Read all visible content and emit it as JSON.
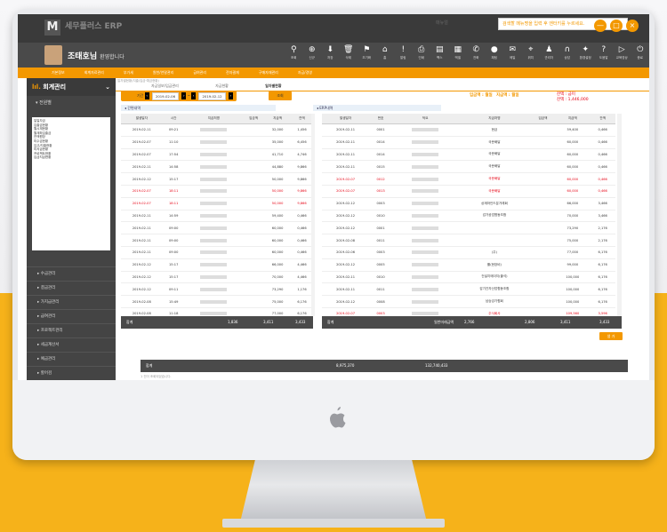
{
  "app": {
    "logo_text": "세무플러스 ERP",
    "top_links": "매뉴얼",
    "search_placeholder": "검색할 메뉴명을 입력 후 엔터키를 누르세요.",
    "user_name": "조태호님",
    "user_greeting": "환영합니다",
    "win_buttons": [
      "—",
      "□",
      "×"
    ]
  },
  "icons": [
    {
      "name": "search-icon",
      "glyph": "⚲",
      "label": "조회"
    },
    {
      "name": "add-icon",
      "glyph": "⊕",
      "label": "신규"
    },
    {
      "name": "save-icon",
      "glyph": "⬇",
      "label": "저장"
    },
    {
      "name": "delete-icon",
      "glyph": "🗑",
      "label": "삭제"
    },
    {
      "name": "flag-icon",
      "glyph": "⚑",
      "label": "초기화"
    },
    {
      "name": "home-icon",
      "glyph": "⌂",
      "label": "홈"
    },
    {
      "name": "alert-icon",
      "glyph": "!",
      "label": "알림"
    },
    {
      "name": "print-icon",
      "glyph": "⎙",
      "label": "인쇄"
    },
    {
      "name": "fax-icon",
      "glyph": "▤",
      "label": "팩스"
    },
    {
      "name": "excel-icon",
      "glyph": "▦",
      "label": "엑셀"
    },
    {
      "name": "phone-icon",
      "glyph": "✆",
      "label": "전화"
    },
    {
      "name": "chat-icon",
      "glyph": "●",
      "label": "채팅"
    },
    {
      "name": "mail-icon",
      "glyph": "✉",
      "label": "메일"
    },
    {
      "name": "location-icon",
      "glyph": "⌖",
      "label": "위치"
    },
    {
      "name": "person-icon",
      "glyph": "♟",
      "label": "관리자"
    },
    {
      "name": "headset-icon",
      "glyph": "∩",
      "label": "상담"
    },
    {
      "name": "settings-icon",
      "glyph": "✦",
      "label": "환경설정"
    },
    {
      "name": "help-icon",
      "glyph": "?",
      "label": "도움말"
    },
    {
      "name": "video-icon",
      "glyph": "▷",
      "label": "교육영상"
    },
    {
      "name": "exit-icon",
      "glyph": "⏻",
      "label": "종료"
    }
  ],
  "menu": [
    "기본정보",
    "회계자료관리",
    "부가세",
    "원천/연말관리",
    "급여관리",
    "전자결재",
    "구매자재관리",
    "자금/경영"
  ],
  "sidebar": {
    "title": "회계관리",
    "sub": "전원별",
    "tree": [
      "일일자금",
      "입출금현황",
      "월시재현황",
      "월계좌입출금",
      "잔액원장",
      "미수금현황",
      "입고/지출현황",
      "미지급현황",
      "프로젝트현황",
      "입금지급현황"
    ],
    "menus": [
      "수금관리",
      "결금관리",
      "가지급관리",
      "급여관리",
      "프로젝트관리",
      "세금계산서",
      "예금관리",
      "할어검"
    ]
  },
  "main": {
    "crumb": "일자별현황(지출/입금·예금현황)",
    "tabs": [
      "자금일보/입금관리",
      "자금현황",
      "일자별현황"
    ],
    "filter_label": "기간",
    "date_from": "2019-02-06",
    "date_to": "2019-02-12",
    "search_btn": "조회",
    "summary_in": "입금액 : 월일",
    "summary_out": "지급액 : 월일",
    "summary_balance_label": "잔액 : 금미",
    "summary_balance_value": "잔액 : 1,446,000",
    "left_panel": {
      "title": "간편내역",
      "headers": [
        "발생일자",
        "시간",
        "지급처명",
        "입금액",
        "지급액",
        "잔액"
      ],
      "rows": [
        {
          "date": "2019-02-11",
          "time": "09:21",
          "amount": "32,000",
          "balance": "1,456",
          "red": false
        },
        {
          "date": "2019-02-07",
          "time": "11:10",
          "amount": "35,000",
          "balance": "6,456",
          "red": false
        },
        {
          "date": "2019-02-07",
          "time": "17:54",
          "amount": "41,710",
          "balance": "4,746",
          "red": false
        },
        {
          "date": "2019-02-11",
          "time": "14:58",
          "amount": "44,880",
          "balance": "9,866",
          "red": false
        },
        {
          "date": "2019-02-12",
          "time": "15:17",
          "amount": "50,000",
          "balance": "9,866",
          "red": false
        },
        {
          "date": "2019-02-07",
          "time": "18:11",
          "amount": "50,000",
          "balance": "9,866",
          "red": true
        },
        {
          "date": "2019-02-07",
          "time": "18:11",
          "amount": "50,000",
          "balance": "9,866",
          "red": true
        },
        {
          "date": "2019-02-11",
          "time": "14:59",
          "amount": "59,400",
          "balance": "0,466",
          "red": false
        },
        {
          "date": "2019-02-11",
          "time": "09:00",
          "amount": "60,000",
          "balance": "0,466",
          "red": false
        },
        {
          "date": "2019-02-11",
          "time": "09:00",
          "amount": "60,000",
          "balance": "0,466",
          "red": false
        },
        {
          "date": "2019-02-11",
          "time": "09:00",
          "amount": "60,000",
          "balance": "0,466",
          "red": false
        },
        {
          "date": "2019-02-12",
          "time": "15:17",
          "amount": "66,000",
          "balance": "4,466",
          "red": false
        },
        {
          "date": "2019-02-12",
          "time": "15:17",
          "amount": "70,000",
          "balance": "4,466",
          "red": false
        },
        {
          "date": "2019-02-12",
          "time": "09:11",
          "amount": "73,290",
          "balance": "1,176",
          "red": false
        },
        {
          "date": "2019-02-08",
          "time": "15:49",
          "amount": "75,000",
          "balance": "6,176",
          "red": false
        },
        {
          "date": "2019-02-08",
          "time": "11:18",
          "amount": "77,000",
          "balance": "6,176",
          "red": false
        }
      ],
      "total_label": "합계",
      "total_in": "1,836",
      "total_out": "3,411",
      "total_balance": "3,433"
    },
    "right_panel": {
      "title": "ERP내역",
      "headers": [
        "발생일자",
        "번호",
        "적요",
        "지급처명",
        "입금액",
        "지급액",
        "잔액"
      ],
      "rows": [
        {
          "date": "2019-02-11",
          "no": "0001",
          "payee": "현금",
          "amount": "59,400",
          "balance": "0,466",
          "red": false
        },
        {
          "date": "2019-02-11",
          "no": "0014",
          "payee": "국문배달",
          "amount": "60,000",
          "balance": "0,466",
          "red": false
        },
        {
          "date": "2019-02-11",
          "no": "0014",
          "payee": "국문배달",
          "amount": "60,000",
          "balance": "0,466",
          "red": false
        },
        {
          "date": "2019-02-11",
          "no": "0015",
          "payee": "국문배달",
          "amount": "60,000",
          "balance": "0,466",
          "red": false
        },
        {
          "date": "2019-02-07",
          "no": "0012",
          "payee": "국문배달",
          "amount": "60,000",
          "balance": "0,466",
          "red": true
        },
        {
          "date": "2019-02-07",
          "no": "0013",
          "payee": "국문배달",
          "amount": "60,000",
          "balance": "0,466",
          "red": true
        },
        {
          "date": "2019-02-12",
          "no": "0003",
          "payee": "상재마인드분거래회",
          "amount": "66,000",
          "balance": "3,466",
          "red": false
        },
        {
          "date": "2019-02-12",
          "no": "0010",
          "payee": "감가공업협동조합",
          "amount": "70,000",
          "balance": "3,466",
          "red": false
        },
        {
          "date": "2019-02-12",
          "no": "0001",
          "payee": "",
          "amount": "73,290",
          "balance": "2,176",
          "red": false
        },
        {
          "date": "2019-02-08",
          "no": "0011",
          "payee": "",
          "amount": "75,000",
          "balance": "2,176",
          "red": false
        },
        {
          "date": "2019-02-06",
          "no": "0003",
          "payee": "(주)",
          "amount": "77,000",
          "balance": "6,176",
          "red": false
        },
        {
          "date": "2019-02-12",
          "no": "0005",
          "payee": "를(현장비)",
          "amount": "99,000",
          "balance": "6,176",
          "red": false
        },
        {
          "date": "2019-02-11",
          "no": "0010",
          "payee": "건설지에이지(출석)",
          "amount": "100,000",
          "balance": "6,176",
          "red": false
        },
        {
          "date": "2019-02-11",
          "no": "0011",
          "payee": "감기관자산업협동조합",
          "amount": "100,000",
          "balance": "6,176",
          "red": false
        },
        {
          "date": "2019-02-12",
          "no": "0008",
          "payee": "남승강기협회",
          "amount": "100,000",
          "balance": "6,176",
          "red": false
        },
        {
          "date": "2019-02-07",
          "no": "0003",
          "payee": "주식회사",
          "amount": "109,560",
          "balance": "3,596",
          "red": true
        }
      ],
      "total_label": "합계",
      "total_text": "일반미래금액",
      "total_in": "2,766",
      "total_out": "2,806",
      "total_out2": "3,411",
      "total_balance": "3,433"
    },
    "orange_btn": "생 가",
    "bottom_total_label": "합계",
    "bottom_total_1": "8,975,370",
    "bottom_total_2": "132,740,433",
    "footnote": "1 건이 조회되었습니다."
  }
}
